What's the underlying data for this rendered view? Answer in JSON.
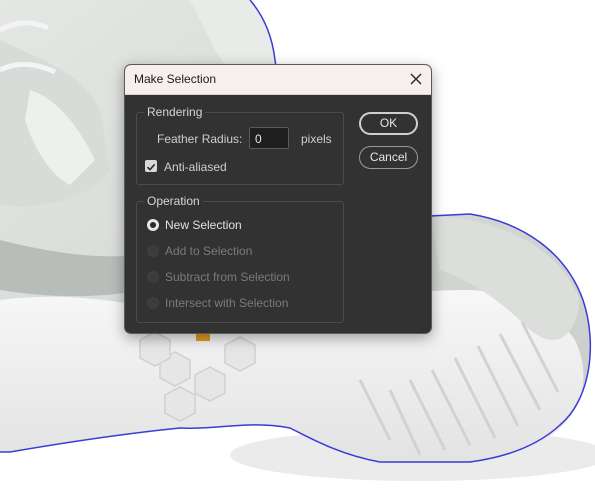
{
  "dialog": {
    "title": "Make Selection",
    "rendering": {
      "title": "Rendering",
      "feather_label": "Feather Radius:",
      "feather_value": "0",
      "feather_unit": "pixels",
      "antialias_label": "Anti-aliased",
      "antialias_checked": true
    },
    "operation": {
      "title": "Operation",
      "options": [
        {
          "label": "New Selection",
          "selected": true,
          "enabled": true
        },
        {
          "label": "Add to Selection",
          "selected": false,
          "enabled": false
        },
        {
          "label": "Subtract from Selection",
          "selected": false,
          "enabled": false
        },
        {
          "label": "Intersect with Selection",
          "selected": false,
          "enabled": false
        }
      ]
    },
    "ok_label": "OK",
    "cancel_label": "Cancel"
  },
  "colors": {
    "dialog_bg": "#323232",
    "titlebar_bg": "#f7eeee",
    "selection_outline": "#3b3bd8",
    "accent_orange": "#e29a1e"
  },
  "icons": {
    "close": "close-icon",
    "checkmark": "checkmark-icon"
  }
}
